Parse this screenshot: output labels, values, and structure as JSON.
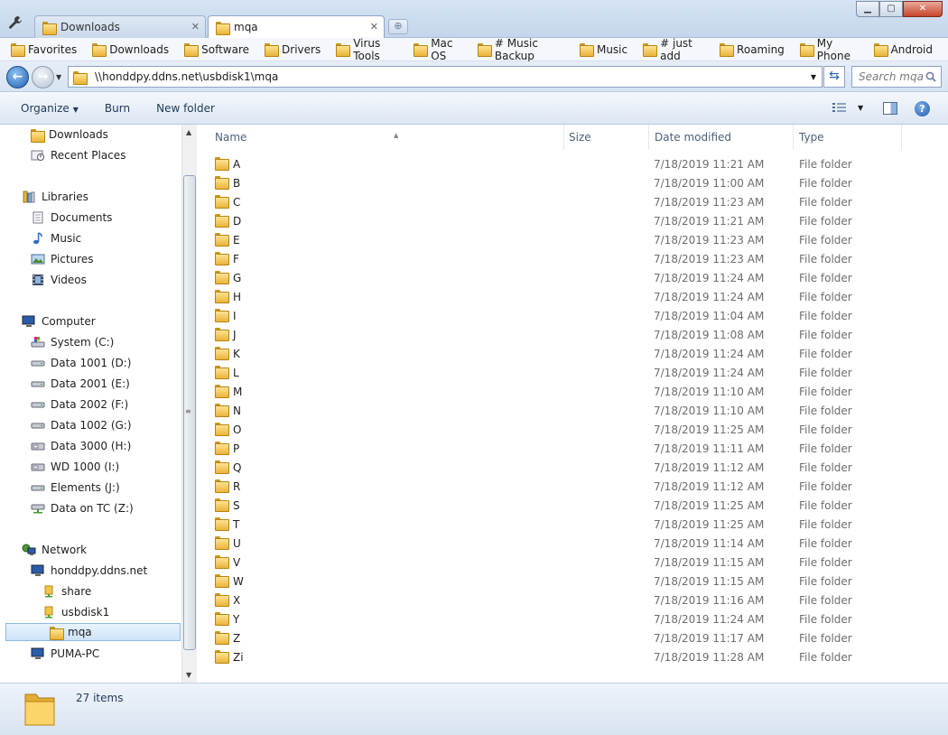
{
  "tabs": [
    {
      "label": "Downloads",
      "active": false
    },
    {
      "label": "mqa",
      "active": true
    }
  ],
  "window_buttons": {
    "minimize": "▁",
    "maximize": "▢",
    "close": "✕"
  },
  "favorites": [
    "Favorites",
    "Downloads",
    "Software",
    "Drivers",
    "Virus Tools",
    "Mac OS",
    "# Music Backup",
    "Music",
    "# just add",
    "Roaming",
    "My Phone",
    "Android"
  ],
  "address": {
    "path": "\\\\honddpy.ddns.net\\usbdisk1\\mqa",
    "search_placeholder": "Search mqa"
  },
  "commands": {
    "organize": "Organize",
    "burn": "Burn",
    "new_folder": "New folder"
  },
  "nav": {
    "downloads": "Downloads",
    "recent": "Recent Places",
    "libraries": "Libraries",
    "documents": "Documents",
    "music": "Music",
    "pictures": "Pictures",
    "videos": "Videos",
    "computer": "Computer",
    "drives": [
      "System (C:)",
      "Data 1001 (D:)",
      "Data 2001 (E:)",
      "Data 2002 (F:)",
      "Data 1002 (G:)",
      "Data 3000 (H:)",
      "WD 1000 (I:)",
      "Elements (J:)",
      "Data on TC (Z:)"
    ],
    "network": "Network",
    "server": "honddpy.ddns.net",
    "share": "share",
    "usbdisk": "usbdisk1",
    "mqa": "mqa",
    "puma": "PUMA-PC"
  },
  "columns": {
    "name": "Name",
    "size": "Size",
    "date": "Date modified",
    "type": "Type"
  },
  "files": [
    {
      "name": "A",
      "date": "7/18/2019 11:21 AM",
      "type": "File folder"
    },
    {
      "name": "B",
      "date": "7/18/2019 11:00 AM",
      "type": "File folder"
    },
    {
      "name": "C",
      "date": "7/18/2019 11:23 AM",
      "type": "File folder"
    },
    {
      "name": "D",
      "date": "7/18/2019 11:21 AM",
      "type": "File folder"
    },
    {
      "name": "E",
      "date": "7/18/2019 11:23 AM",
      "type": "File folder"
    },
    {
      "name": "F",
      "date": "7/18/2019 11:23 AM",
      "type": "File folder"
    },
    {
      "name": "G",
      "date": "7/18/2019 11:24 AM",
      "type": "File folder"
    },
    {
      "name": "H",
      "date": "7/18/2019 11:24 AM",
      "type": "File folder"
    },
    {
      "name": "I",
      "date": "7/18/2019 11:04 AM",
      "type": "File folder"
    },
    {
      "name": "J",
      "date": "7/18/2019 11:08 AM",
      "type": "File folder"
    },
    {
      "name": "K",
      "date": "7/18/2019 11:24 AM",
      "type": "File folder"
    },
    {
      "name": "L",
      "date": "7/18/2019 11:24 AM",
      "type": "File folder"
    },
    {
      "name": "M",
      "date": "7/18/2019 11:10 AM",
      "type": "File folder"
    },
    {
      "name": "N",
      "date": "7/18/2019 11:10 AM",
      "type": "File folder"
    },
    {
      "name": "O",
      "date": "7/18/2019 11:25 AM",
      "type": "File folder"
    },
    {
      "name": "P",
      "date": "7/18/2019 11:11 AM",
      "type": "File folder"
    },
    {
      "name": "Q",
      "date": "7/18/2019 11:12 AM",
      "type": "File folder"
    },
    {
      "name": "R",
      "date": "7/18/2019 11:12 AM",
      "type": "File folder"
    },
    {
      "name": "S",
      "date": "7/18/2019 11:25 AM",
      "type": "File folder"
    },
    {
      "name": "T",
      "date": "7/18/2019 11:25 AM",
      "type": "File folder"
    },
    {
      "name": "U",
      "date": "7/18/2019 11:14 AM",
      "type": "File folder"
    },
    {
      "name": "V",
      "date": "7/18/2019 11:15 AM",
      "type": "File folder"
    },
    {
      "name": "W",
      "date": "7/18/2019 11:15 AM",
      "type": "File folder"
    },
    {
      "name": "X",
      "date": "7/18/2019 11:16 AM",
      "type": "File folder"
    },
    {
      "name": "Y",
      "date": "7/18/2019 11:24 AM",
      "type": "File folder"
    },
    {
      "name": "Z",
      "date": "7/18/2019 11:17 AM",
      "type": "File folder"
    },
    {
      "name": "Zi",
      "date": "7/18/2019 11:28 AM",
      "type": "File folder"
    }
  ],
  "status": {
    "item_count": "27 items"
  }
}
